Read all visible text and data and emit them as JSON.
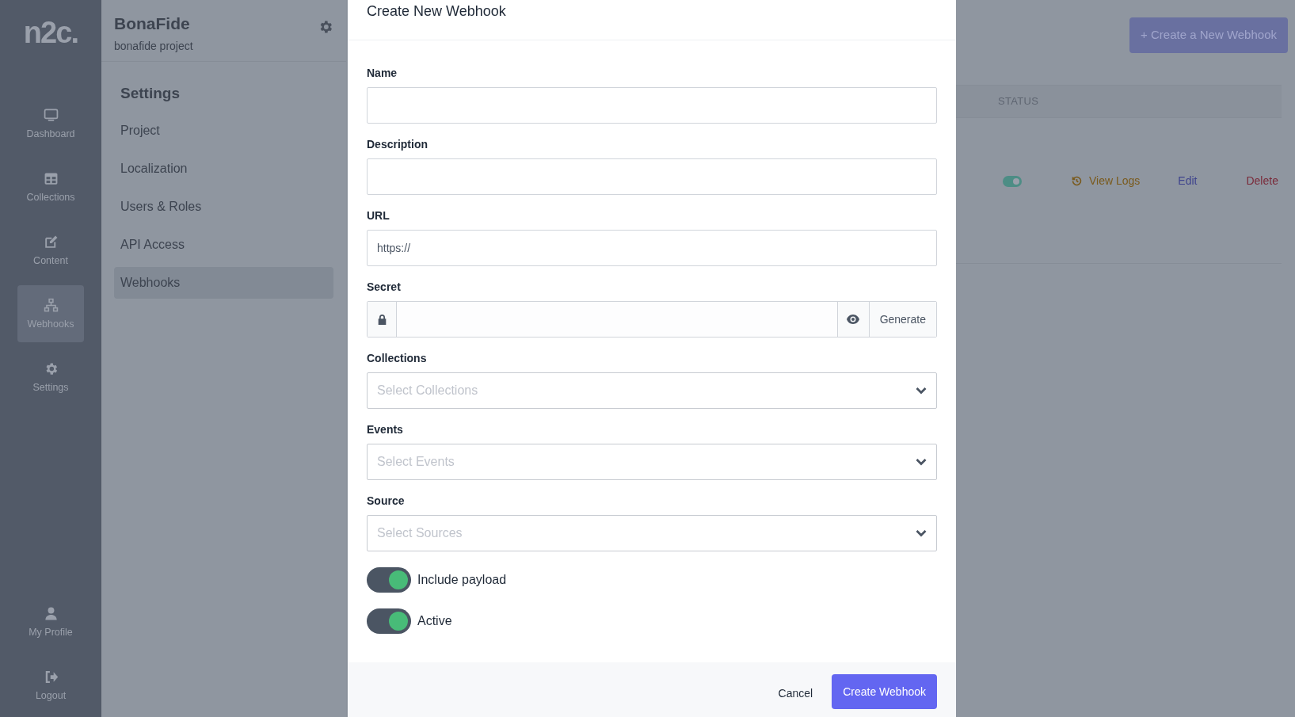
{
  "logo": "n2c.",
  "nav": [
    {
      "kind": "monitor",
      "label": "Dashboard",
      "selected": false
    },
    {
      "kind": "table",
      "label": "Collections",
      "selected": false
    },
    {
      "kind": "edit",
      "label": "Content",
      "selected": false
    },
    {
      "kind": "network",
      "label": "Webhooks",
      "selected": true
    },
    {
      "kind": "gear",
      "label": "Settings",
      "selected": false
    }
  ],
  "nav_bottom": [
    {
      "kind": "user",
      "label": "My Profile",
      "selected": false
    },
    {
      "kind": "logout",
      "label": "Logout",
      "selected": false
    }
  ],
  "project": {
    "name": "BonaFide",
    "subtitle": "bonafide project"
  },
  "settings_menu": {
    "title": "Settings",
    "items": [
      {
        "label": "Project",
        "selected": false
      },
      {
        "label": "Localization",
        "selected": false
      },
      {
        "label": "Users & Roles",
        "selected": false
      },
      {
        "label": "API Access",
        "selected": false
      },
      {
        "label": "Webhooks",
        "selected": true
      }
    ]
  },
  "page": {
    "create_button": "+ Create a New Webhook",
    "columns": [
      "STATUS"
    ],
    "rows": [
      {
        "status_on": true,
        "actions": [
          "View Logs",
          "Edit",
          "Delete"
        ]
      }
    ]
  },
  "modal": {
    "title": "Create New Webhook",
    "fields": [
      {
        "kind": "text",
        "label": "Name"
      },
      {
        "kind": "text",
        "label": "Description"
      },
      {
        "kind": "text",
        "label": "URL",
        "value": "https://"
      },
      {
        "kind": "secret",
        "label": "Secret",
        "button": "Generate"
      },
      {
        "kind": "select",
        "label": "Collections",
        "placeholder": "Select Collections"
      },
      {
        "kind": "select",
        "label": "Events",
        "placeholder": "Select Events"
      },
      {
        "kind": "select",
        "label": "Source",
        "placeholder": "Select Sources"
      }
    ],
    "toggles": [
      {
        "label": "Include payload",
        "on": true
      },
      {
        "label": "Active",
        "on": true
      }
    ],
    "cancel": "Cancel",
    "submit": "Create Webhook"
  }
}
